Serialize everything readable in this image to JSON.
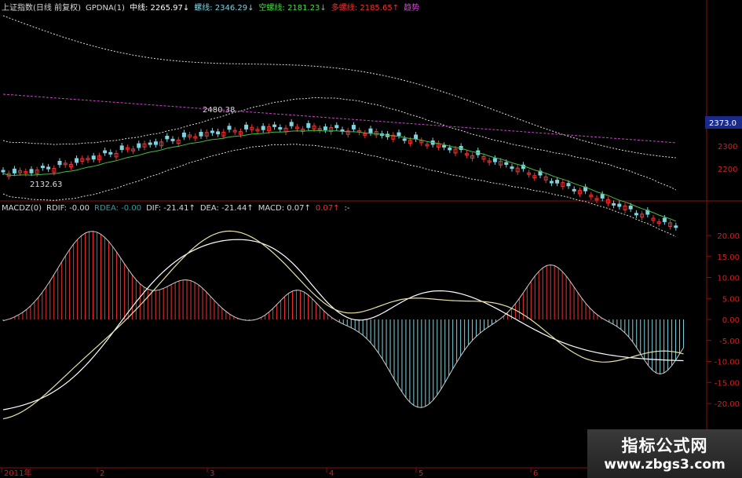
{
  "upper_legend": [
    {
      "text": "上证指数(日线 前复权)",
      "color": "#d8d8d8"
    },
    {
      "text": "GPDNA(1)",
      "color": "#d8d8d8"
    },
    {
      "text": "中线: 2265.97↓",
      "color": "#ffffff"
    },
    {
      "text": "螺线: 2346.29↓",
      "color": "#7fd4e0"
    },
    {
      "text": "空螺线: 2181.23↓",
      "color": "#44dd44"
    },
    {
      "text": "多螺线: 2185.65↑",
      "color": "#ee3333"
    },
    {
      "text": "趋势",
      "color": "#dd44dd"
    }
  ],
  "lower_legend": [
    {
      "text": "MACDZ(0)",
      "color": "#d8d8d8"
    },
    {
      "text": "RDIF: -0.00",
      "color": "#d8d8d8"
    },
    {
      "text": "RDEA: -0.00",
      "color": "#2aa0a0"
    },
    {
      "text": "DIF: -21.41↑",
      "color": "#d8d8d8"
    },
    {
      "text": "DEA: -21.44↑",
      "color": "#d8d8d8"
    },
    {
      "text": "MACD: 0.07↑",
      "color": "#d8d8d8"
    },
    {
      "text": "0.07↑",
      "color": "#ee3333"
    },
    {
      "text": ":-",
      "color": "#d8d8d8"
    }
  ],
  "price_axis": {
    "current_price": "2373.0",
    "current_price_bg": "#1a2a8a",
    "labels": [
      "2300",
      "2200"
    ]
  },
  "macd_axis": {
    "labels": [
      "20.00",
      "15.00",
      "10.00",
      "5.00",
      "0.00",
      "-5.00",
      "-10.00",
      "-15.00",
      "-20.00"
    ]
  },
  "annotations": {
    "low": "2132.63",
    "high": "2480.38"
  },
  "time_axis": [
    "2011年",
    "2",
    "3",
    "4",
    "5",
    "6"
  ],
  "watermark": {
    "title": "指标公式网",
    "url": "www.zbgs3.com"
  },
  "colors": {
    "up": "#ee3333",
    "down": "#7fd4e0",
    "grid_red": "#8a1010",
    "dif": "#ffffff",
    "dea": "#e8e0a8",
    "macd_pos": "#ee3333",
    "macd_neg": "#7fd4e0",
    "trend": "#cc44cc",
    "mid": "#44bb44",
    "band": "#dddddd"
  }
}
